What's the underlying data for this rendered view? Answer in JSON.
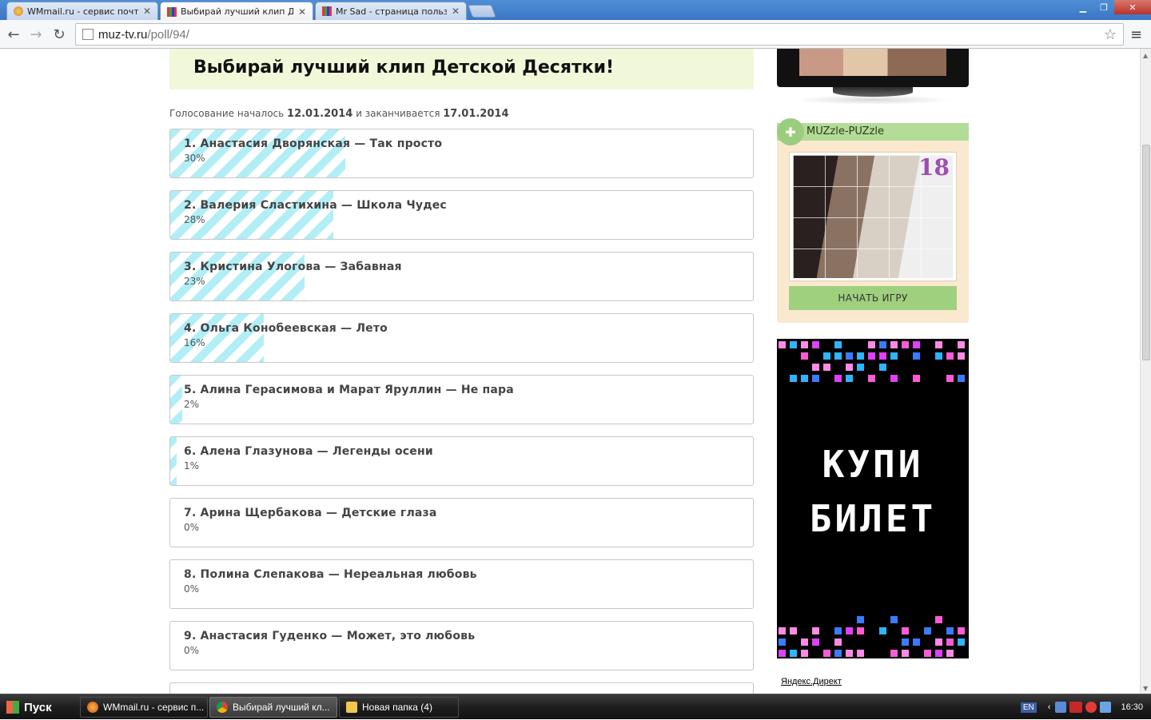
{
  "browser": {
    "tabs": [
      {
        "title": "WMmail.ru - сервис почтов",
        "active": false
      },
      {
        "title": "Выбирай лучший клип Детс",
        "active": true
      },
      {
        "title": "Mr Sad - страница пользов",
        "active": false
      }
    ],
    "url_host": "muz-tv.ru",
    "url_path": "/poll/94/"
  },
  "page": {
    "heading": "Выбирай лучший клип Детской Десятки!",
    "dates": {
      "prefix": "Голосование началось",
      "start": "12.01.2014",
      "middle": "и заканчивается",
      "end": "17.01.2014"
    },
    "poll_items": [
      {
        "label": "1. Анастасия Дворянская — Так просто",
        "percent_text": "30%",
        "percent": 30
      },
      {
        "label": "2. Валерия Сластихина — Школа Чудес",
        "percent_text": "28%",
        "percent": 28
      },
      {
        "label": "3. Кристина Улогова — Забавная",
        "percent_text": "23%",
        "percent": 23
      },
      {
        "label": "4. Ольга Конобеевская — Лето",
        "percent_text": "16%",
        "percent": 16
      },
      {
        "label": "5. Алина Герасимова и Марат Яруллин — Не пара",
        "percent_text": "2%",
        "percent": 2
      },
      {
        "label": "6. Алена Глазунова — Легенды осени",
        "percent_text": "1%",
        "percent": 1
      },
      {
        "label": "7. Арина Щербакова — Детские глаза",
        "percent_text": "0%",
        "percent": 0
      },
      {
        "label": "8. Полина Слепакова — Нереальная любовь",
        "percent_text": "0%",
        "percent": 0
      },
      {
        "label": "9. Анастасия Гуденко — Может, это любовь",
        "percent_text": "0%",
        "percent": 0
      }
    ],
    "sidebar": {
      "puzzle_title": "MUZzle-PUZzle",
      "puzzle_number": "18",
      "puzzle_button": "НАЧАТЬ ИГРУ",
      "ad_line1": "КУПИ",
      "ad_line2": "БИЛЕТ",
      "yandex_link": "Яндекс.Директ"
    }
  },
  "taskbar": {
    "start_label": "Пуск",
    "tasks": [
      {
        "title": "WMmail.ru - сервис п...",
        "active": false
      },
      {
        "title": "Выбирай лучший кл...",
        "active": true
      },
      {
        "title": "Новая папка (4)",
        "active": false
      }
    ],
    "lang": "EN",
    "time": "16:30"
  },
  "colors": {
    "header_bg": "#f1f8da",
    "bar_stripe": "#a8ecf5",
    "puzzle_green": "#9fd07e",
    "puzzle_bg": "#fbe9cf"
  }
}
